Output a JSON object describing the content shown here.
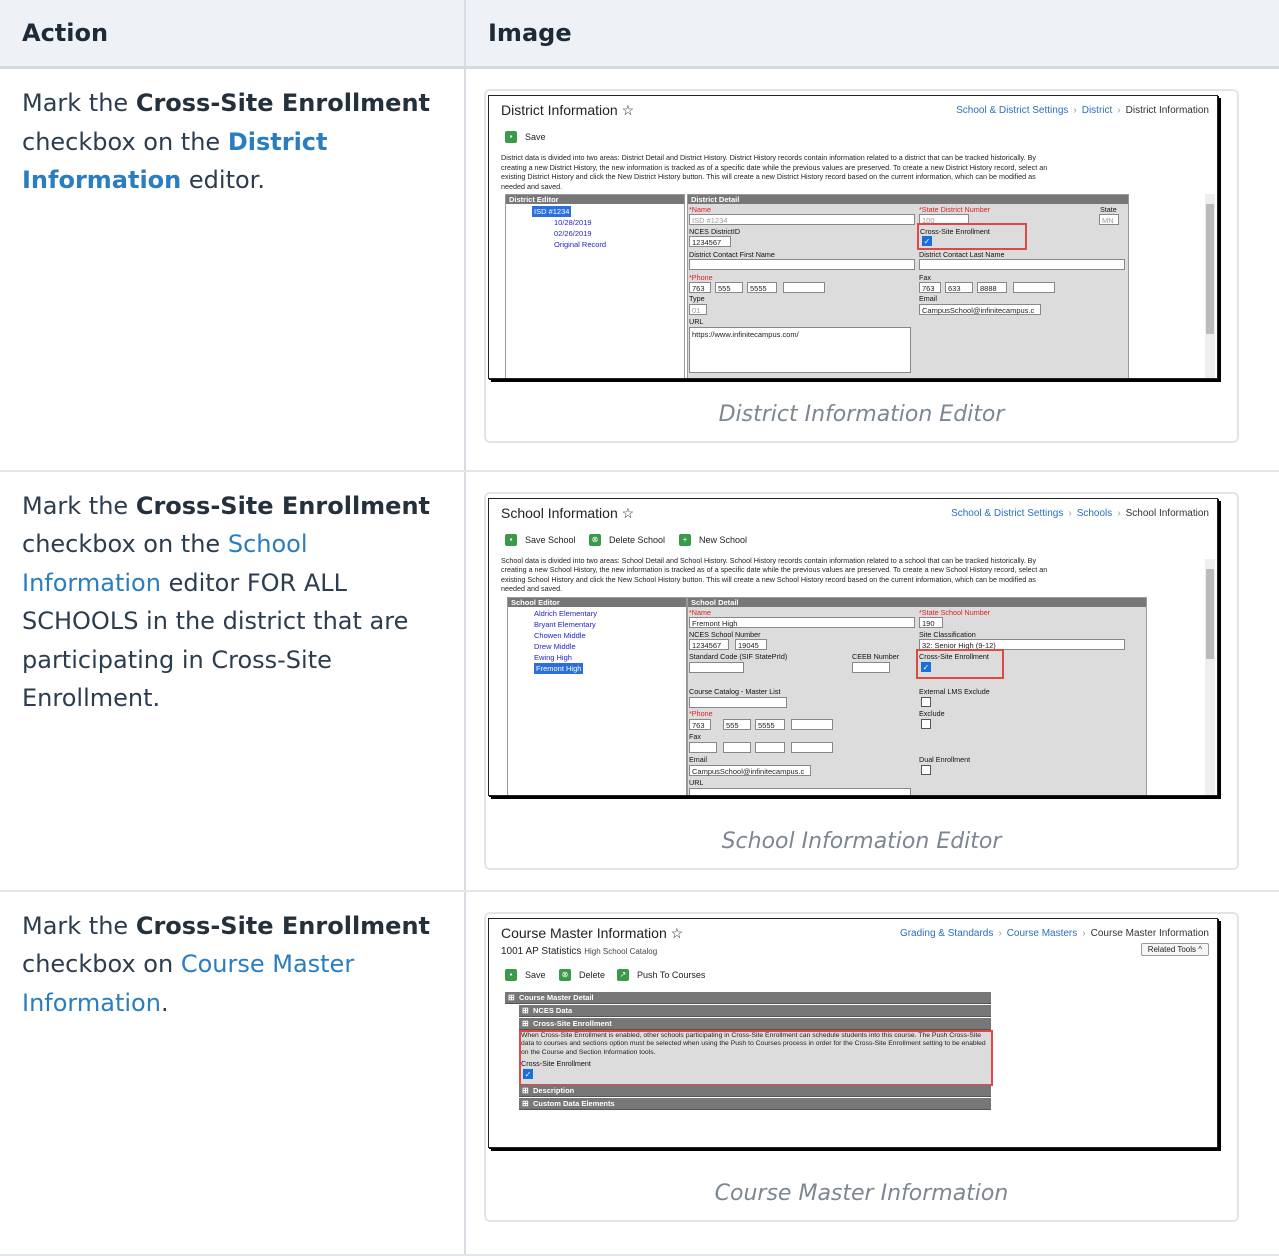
{
  "table": {
    "headers": {
      "action": "Action",
      "image": "Image"
    },
    "rows": [
      {
        "action": {
          "pre": "Mark the ",
          "bold": "Cross-Site Enrollment",
          "mid": " checkbox on the ",
          "link": "District Information",
          "post": " editor."
        },
        "caption": "District Information Editor",
        "shot": {
          "title": "District Information ☆",
          "crumbs": [
            "School & District Settings",
            "District",
            "District Information"
          ],
          "buttons": [
            "Save"
          ],
          "desc": "District data is divided into two areas: District Detail and District History. District History records contain information related to a district that can be tracked historically. By creating a new District History, the new information is tracked as of a specific date while the previous values are preserved. To create a new District History record, select an existing District History and click the New District History button. This will create a new District History record based on the current information, which can be modified as needed and saved.",
          "tree_header": "District Editor",
          "tree_nodes": [
            "ISD #1234",
            "10/28/2019",
            "02/26/2019",
            "Original Record"
          ],
          "panel_header": "District Detail",
          "fields": {
            "name_label": "*Name",
            "name_value": "ISD #1234",
            "state_num_label": "*State District Number",
            "state_num_value": "100",
            "state_label": "State",
            "state_value": "MN",
            "nces_label": "NCES DistrictID",
            "nces_value": "1234567",
            "cse_label": "Cross-Site Enrollment",
            "contact_first": "District Contact First Name",
            "contact_last": "District Contact Last Name",
            "phone_label": "*Phone",
            "phone": [
              "763",
              "555",
              "5555"
            ],
            "fax_label": "Fax",
            "fax": [
              "763",
              "633",
              "8888"
            ],
            "type_label": "Type",
            "type_value": "01",
            "email_label": "Email",
            "email_value": "CampusSchool@infinitecampus.c",
            "url_label": "URL",
            "url_value": "https://www.infinitecampus.com/"
          }
        }
      },
      {
        "action": {
          "pre": "Mark the ",
          "bold": "Cross-Site Enrollment",
          "mid": " checkbox on the ",
          "link": "School Information",
          "post": " editor FOR ALL SCHOOLS in the district that are participating in Cross-Site Enrollment."
        },
        "caption": "School Information Editor",
        "shot": {
          "title": "School Information ☆",
          "crumbs": [
            "School & District Settings",
            "Schools",
            "School Information"
          ],
          "buttons": [
            "Save School",
            "Delete School",
            "New School"
          ],
          "desc": "School data is divided into two areas: School Detail and School History. School History records contain information related to a school that can be tracked historically. By creating a new School History, the new information is tracked as of a specific date while the previous values are preserved. To create a new School History record, select an existing School History and click the New School History button. This will create a new School History record based on the current information, which can be modified as needed and saved.",
          "tree_header": "School Editor",
          "tree_nodes": [
            "Aldrich Elementary",
            "Bryant Elementary",
            "Chowen Middle",
            "Drew Middle",
            "Ewing High",
            "Fremont High"
          ],
          "panel_header": "School Detail",
          "fields": {
            "name_label": "*Name",
            "name_value": "Fremont High",
            "state_num_label": "*State School Number",
            "state_num_value": "190",
            "nces_label": "NCES School Number",
            "nces_value": "1234567",
            "nces_value2": "19045",
            "site_label": "Site Classification",
            "site_value": "32: Senior High (9-12)",
            "std_label": "Standard Code (SIF StatePrId)",
            "ceeb_label": "CEEB Number",
            "cse_label": "Cross-Site Enrollment",
            "catalog_label": "Course Catalog - Master List",
            "lms_label": "External LMS Exclude",
            "phone_label": "*Phone",
            "phone": [
              "763",
              "555",
              "5555"
            ],
            "exclude_label": "Exclude",
            "fax_label": "Fax",
            "email_label": "Email",
            "email_value": "CampusSchool@infinitecampus.c",
            "dual_label": "Dual Enrollment",
            "url_label": "URL"
          }
        }
      },
      {
        "action": {
          "pre": "Mark the ",
          "bold": "Cross-Site Enrollment",
          "mid": " checkbox on ",
          "link": "Course Master Information",
          "post": "."
        },
        "caption": "Course Master Information",
        "shot": {
          "title": "Course Master Information ☆",
          "crumbs": [
            "Grading & Standards",
            "Course Masters",
            "Course Master Information"
          ],
          "subtitle": "1001 AP Statistics",
          "subtitle_extra": "High School Catalog",
          "related_tools": "Related Tools ^",
          "buttons": [
            "Save",
            "Delete",
            "Push To Courses"
          ],
          "sections": [
            "Course Master Detail",
            "NCES Data",
            "Cross-Site Enrollment",
            "Description",
            "Custom Data Elements"
          ],
          "cse_text": "When Cross-Site Enrollment is enabled, other schools participating in Cross-Site Enrollment can schedule students into this course. The Push Cross-Site data to courses and sections option must be selected when using the Push to Courses process in order for the Cross-Site Enrollment setting to be enabled on the Course and Section Information tools.",
          "cse_label": "Cross-Site Enrollment"
        }
      }
    ]
  },
  "colors": {
    "header_bg": "#eef2f6",
    "link": "#2a7ec0",
    "highlight": "#e04848",
    "check": "#1c6fd8"
  }
}
